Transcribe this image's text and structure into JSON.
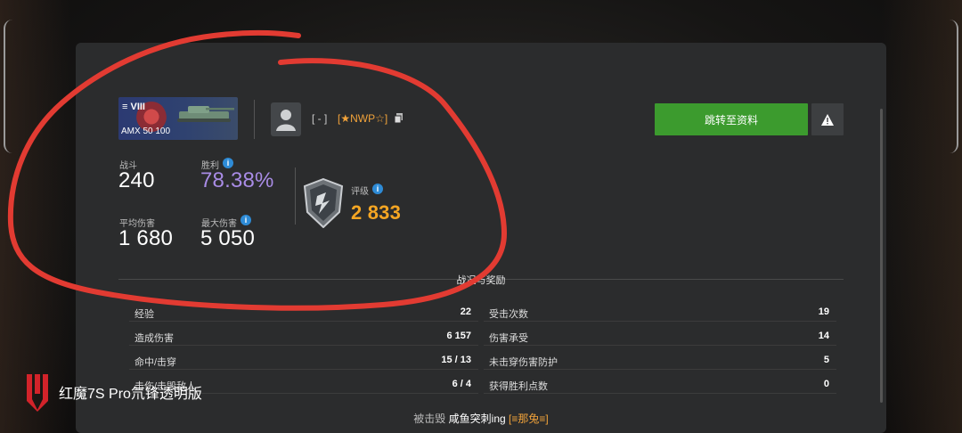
{
  "colors": {
    "panel_bg": "#2b2c2d",
    "button_green": "#3c9b2e",
    "accent_orange": "#f5a623",
    "winrate_purple": "#a98ce6",
    "info_blue": "#2e8bd6",
    "annotation_red": "#e23b32"
  },
  "tank": {
    "tier": "VIII",
    "name": "AMX 50 100"
  },
  "player": {
    "clan_tag": "[ - ]",
    "clan_name": "[★NWP☆]",
    "avatar_icon": "silhouette-icon",
    "copy_icon": "copy-icon"
  },
  "actions": {
    "goto_profile": "跳转至资料",
    "report_icon": "warning-icon"
  },
  "stats": {
    "battles_label": "战斗",
    "battles_value": "240",
    "winrate_label": "胜利",
    "winrate_value": "78.38%",
    "avg_damage_label": "平均伤害",
    "avg_damage_value": "1 680",
    "max_damage_label": "最大伤害",
    "max_damage_value": "5 050",
    "rating_label": "评级",
    "rating_value": "2 833",
    "info_icon": "info-icon"
  },
  "section": {
    "title": "战况与奖励"
  },
  "left_rows": [
    {
      "label": "经验",
      "value": "22"
    },
    {
      "label": "造成伤害",
      "value": "6 157"
    },
    {
      "label": "命中/击穿",
      "value": "15 / 13"
    },
    {
      "label": "击伤/击毁敌人",
      "value": "6 / 4"
    }
  ],
  "right_rows": [
    {
      "label": "受击次数",
      "value": "19"
    },
    {
      "label": "伤害承受",
      "value": "14"
    },
    {
      "label": "未击穿伤害防护",
      "value": "5"
    },
    {
      "label": "获得胜利点数",
      "value": "0"
    }
  ],
  "killed_by": {
    "prefix": "被击毁",
    "name": "咸鱼突刺ing",
    "clan": "[≡那兔≡]"
  },
  "watermark": {
    "text": "红魔7S Pro氘锋透明版"
  }
}
